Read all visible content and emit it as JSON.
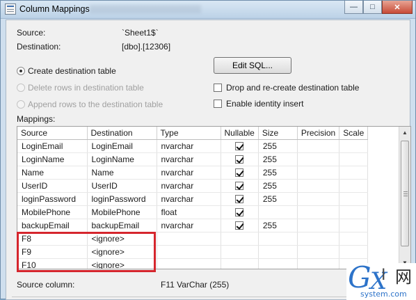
{
  "window": {
    "title": "Column Mappings",
    "controls": {
      "minimize": "—",
      "maximize": "□",
      "close": "✕"
    }
  },
  "info": {
    "source_label": "Source:",
    "source_value": "`Sheet1$`",
    "destination_label": "Destination:",
    "destination_value": "[dbo].[12306]"
  },
  "options": {
    "create_destination": {
      "label": "Create destination table",
      "checked": true,
      "enabled": true
    },
    "delete_rows": {
      "label": "Delete rows in destination table",
      "checked": false,
      "enabled": false
    },
    "append_rows": {
      "label": "Append rows to the destination table",
      "checked": false,
      "enabled": false
    },
    "edit_sql": "Edit SQL...",
    "drop_recreate": {
      "label": "Drop and re-create destination table",
      "checked": false
    },
    "identity_insert": {
      "label": "Enable identity insert",
      "checked": false
    }
  },
  "mappings": {
    "label": "Mappings:",
    "columns": [
      "Source",
      "Destination",
      "Type",
      "Nullable",
      "Size",
      "Precision",
      "Scale"
    ],
    "rows": [
      {
        "source": "LoginEmail",
        "destination": "LoginEmail",
        "type": "nvarchar",
        "nullable": true,
        "size": "255",
        "precision": "",
        "scale": ""
      },
      {
        "source": "LoginName",
        "destination": "LoginName",
        "type": "nvarchar",
        "nullable": true,
        "size": "255",
        "precision": "",
        "scale": ""
      },
      {
        "source": "Name",
        "destination": "Name",
        "type": "nvarchar",
        "nullable": true,
        "size": "255",
        "precision": "",
        "scale": ""
      },
      {
        "source": "UserID",
        "destination": "UserID",
        "type": "nvarchar",
        "nullable": true,
        "size": "255",
        "precision": "",
        "scale": ""
      },
      {
        "source": "loginPassword",
        "destination": "loginPassword",
        "type": "nvarchar",
        "nullable": true,
        "size": "255",
        "precision": "",
        "scale": ""
      },
      {
        "source": "MobilePhone",
        "destination": "MobilePhone",
        "type": "float",
        "nullable": true,
        "size": "",
        "precision": "",
        "scale": ""
      },
      {
        "source": "backupEmail",
        "destination": "backupEmail",
        "type": "nvarchar",
        "nullable": true,
        "size": "255",
        "precision": "",
        "scale": ""
      },
      {
        "source": "F8",
        "destination": "<ignore>",
        "type": "",
        "nullable": false,
        "size": "",
        "precision": "",
        "scale": ""
      },
      {
        "source": "F9",
        "destination": "<ignore>",
        "type": "",
        "nullable": false,
        "size": "",
        "precision": "",
        "scale": ""
      },
      {
        "source": "F10",
        "destination": "<ignore>",
        "type": "",
        "nullable": false,
        "size": "",
        "precision": "",
        "scale": ""
      }
    ]
  },
  "status": {
    "source_column_label": "Source column:",
    "source_column_value": "F11 VarChar (255)"
  },
  "watermark": {
    "g": "G",
    "x": "X",
    "i": "I",
    "wang": "网",
    "site": "system.com"
  },
  "colors": {
    "highlight": "#d5262d",
    "titlebar": "#bcd2e7"
  }
}
